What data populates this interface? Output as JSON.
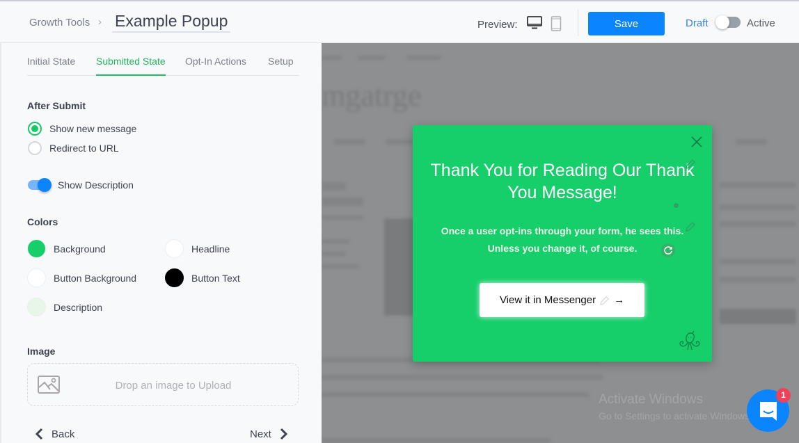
{
  "header": {
    "breadcrumb": "Growth Tools",
    "breadcrumb_separator": "›",
    "title_value": "Example Popup",
    "preview_label": "Preview:",
    "preview_devices": [
      "desktop-icon",
      "mobile-icon"
    ],
    "save_label": "Save",
    "status_off_label": "Draft",
    "status_on_label": "Active",
    "status_active": false
  },
  "sidebar": {
    "tabs": [
      {
        "label": "Initial State",
        "active": false
      },
      {
        "label": "Submitted State",
        "active": true
      },
      {
        "label": "Opt-In Actions",
        "active": false
      },
      {
        "label": "Setup",
        "active": false
      }
    ],
    "after_submit": {
      "title": "After Submit",
      "options": [
        {
          "label": "Show new message",
          "checked": true
        },
        {
          "label": "Redirect to URL",
          "checked": false
        }
      ]
    },
    "show_description": {
      "label": "Show Description",
      "enabled": true
    },
    "colors": {
      "title": "Colors",
      "items": [
        {
          "label": "Background",
          "color": "#16ce6a"
        },
        {
          "label": "Headline",
          "color": "#ffffff"
        },
        {
          "label": "Button Background",
          "color": "#ffffff"
        },
        {
          "label": "Button Text",
          "color": "#000000"
        },
        {
          "label": "Description",
          "color": "#e8f5e9"
        }
      ]
    },
    "image": {
      "title": "Image",
      "dropzone_text": "Drop an image to Upload"
    },
    "nav": {
      "back_label": "Back",
      "next_label": "Next"
    }
  },
  "preview": {
    "popup": {
      "headline": "Thank You for Reading Our Thank You Message!",
      "description": "Once a user opt-ins through your form, he sees this. Unless you change it, of course.",
      "button_label": "View it in Messenger",
      "button_arrow": "→",
      "background_color": "#16ce6a"
    },
    "watermark": {
      "title": "Activate Windows",
      "subtitle": "Go to Settings to activate Windows."
    },
    "chat_widget": {
      "badge_count": "1"
    }
  }
}
